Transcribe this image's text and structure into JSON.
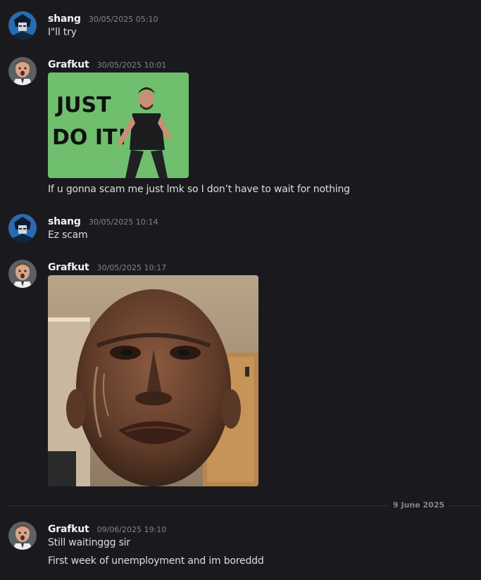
{
  "messages": [
    {
      "author": "shang",
      "time": "30/05/2025 05:10",
      "lines": [
        "I\"ll try"
      ]
    },
    {
      "author": "Grafkut",
      "time": "30/05/2025 10:01",
      "image_text_1": "JUST",
      "image_text_2": "DO IT!",
      "lines": [
        "If u gonna scam me just lmk so I don’t have to wait for nothing"
      ]
    },
    {
      "author": "shang",
      "time": "30/05/2025 10:14",
      "lines": [
        "Ez scam"
      ]
    },
    {
      "author": "Grafkut",
      "time": "30/05/2025 10:17",
      "lines": []
    },
    {
      "author": "Grafkut",
      "time": "09/06/2025 19:10",
      "lines": [
        "Still waitinggg sir",
        "First week of unemployment and im boreddd"
      ]
    }
  ],
  "date_divider": "9 June 2025",
  "colors": {
    "background": "#1a1a1e",
    "username": "#f2f3f5",
    "timestamp": "#80848e",
    "text": "#dbdee1",
    "gif_green": "#6fbf6e"
  },
  "icons": {
    "shang_avatar": "anime-character-avatar",
    "grafkut_avatar": "surprised-man-avatar"
  }
}
